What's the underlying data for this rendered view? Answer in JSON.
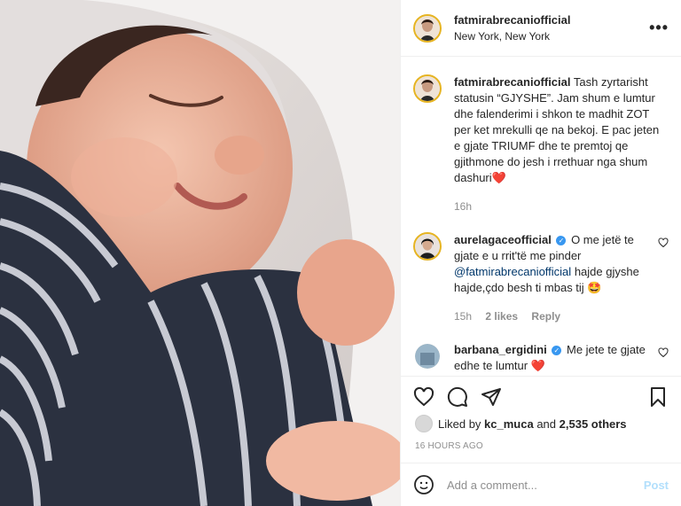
{
  "post": {
    "image_alt": "sleeping baby",
    "author": "fatmirabrecaniofficial",
    "location": "New York, New York",
    "more_label": "•••"
  },
  "caption": {
    "user": "fatmirabrecaniofficial",
    "text": "Tash zyrtarisht statusin “GJYSHE”. Jam shum e lumtur dhe falenderimi i shkon te madhit ZOT per ket mrekulli qe na bekoj. E pac jeten e gjate TRIUMF dhe te premtoj qe gjithmone do jesh i rrethuar nga shum dashuri❤️",
    "time": "16h"
  },
  "comments": [
    {
      "user": "aurelagaceofficial",
      "verified": true,
      "text_before": "O me jetë te gjate e u rrit'të me pinder",
      "mention": "@fatmirabrecaniofficial",
      "text_after": "hajde gjyshe hajde,çdo besh ti mbas tij 🤩",
      "time": "15h",
      "likes": "2 likes",
      "reply": "Reply"
    },
    {
      "user": "barbana_ergidini",
      "verified": true,
      "text": "Me jete te gjate edhe te lumtur ❤️",
      "time": "",
      "likes": "",
      "reply": ""
    }
  ],
  "likes": {
    "prefix": "Liked by",
    "user": "kc_muca",
    "and": "and",
    "others": "2,535 others"
  },
  "timestamp": "16 HOURS AGO",
  "add_comment": {
    "placeholder": "Add a comment...",
    "post_label": "Post"
  },
  "icons": {
    "like": "heart-icon",
    "comment": "comment-icon",
    "share": "share-icon",
    "save": "bookmark-icon",
    "emoji": "emoji-icon",
    "more": "more-icon"
  },
  "colors": {
    "link": "#00376b",
    "post_disabled": "#b2dffc",
    "verified": "#3897f0",
    "heart": "#ed4956"
  }
}
